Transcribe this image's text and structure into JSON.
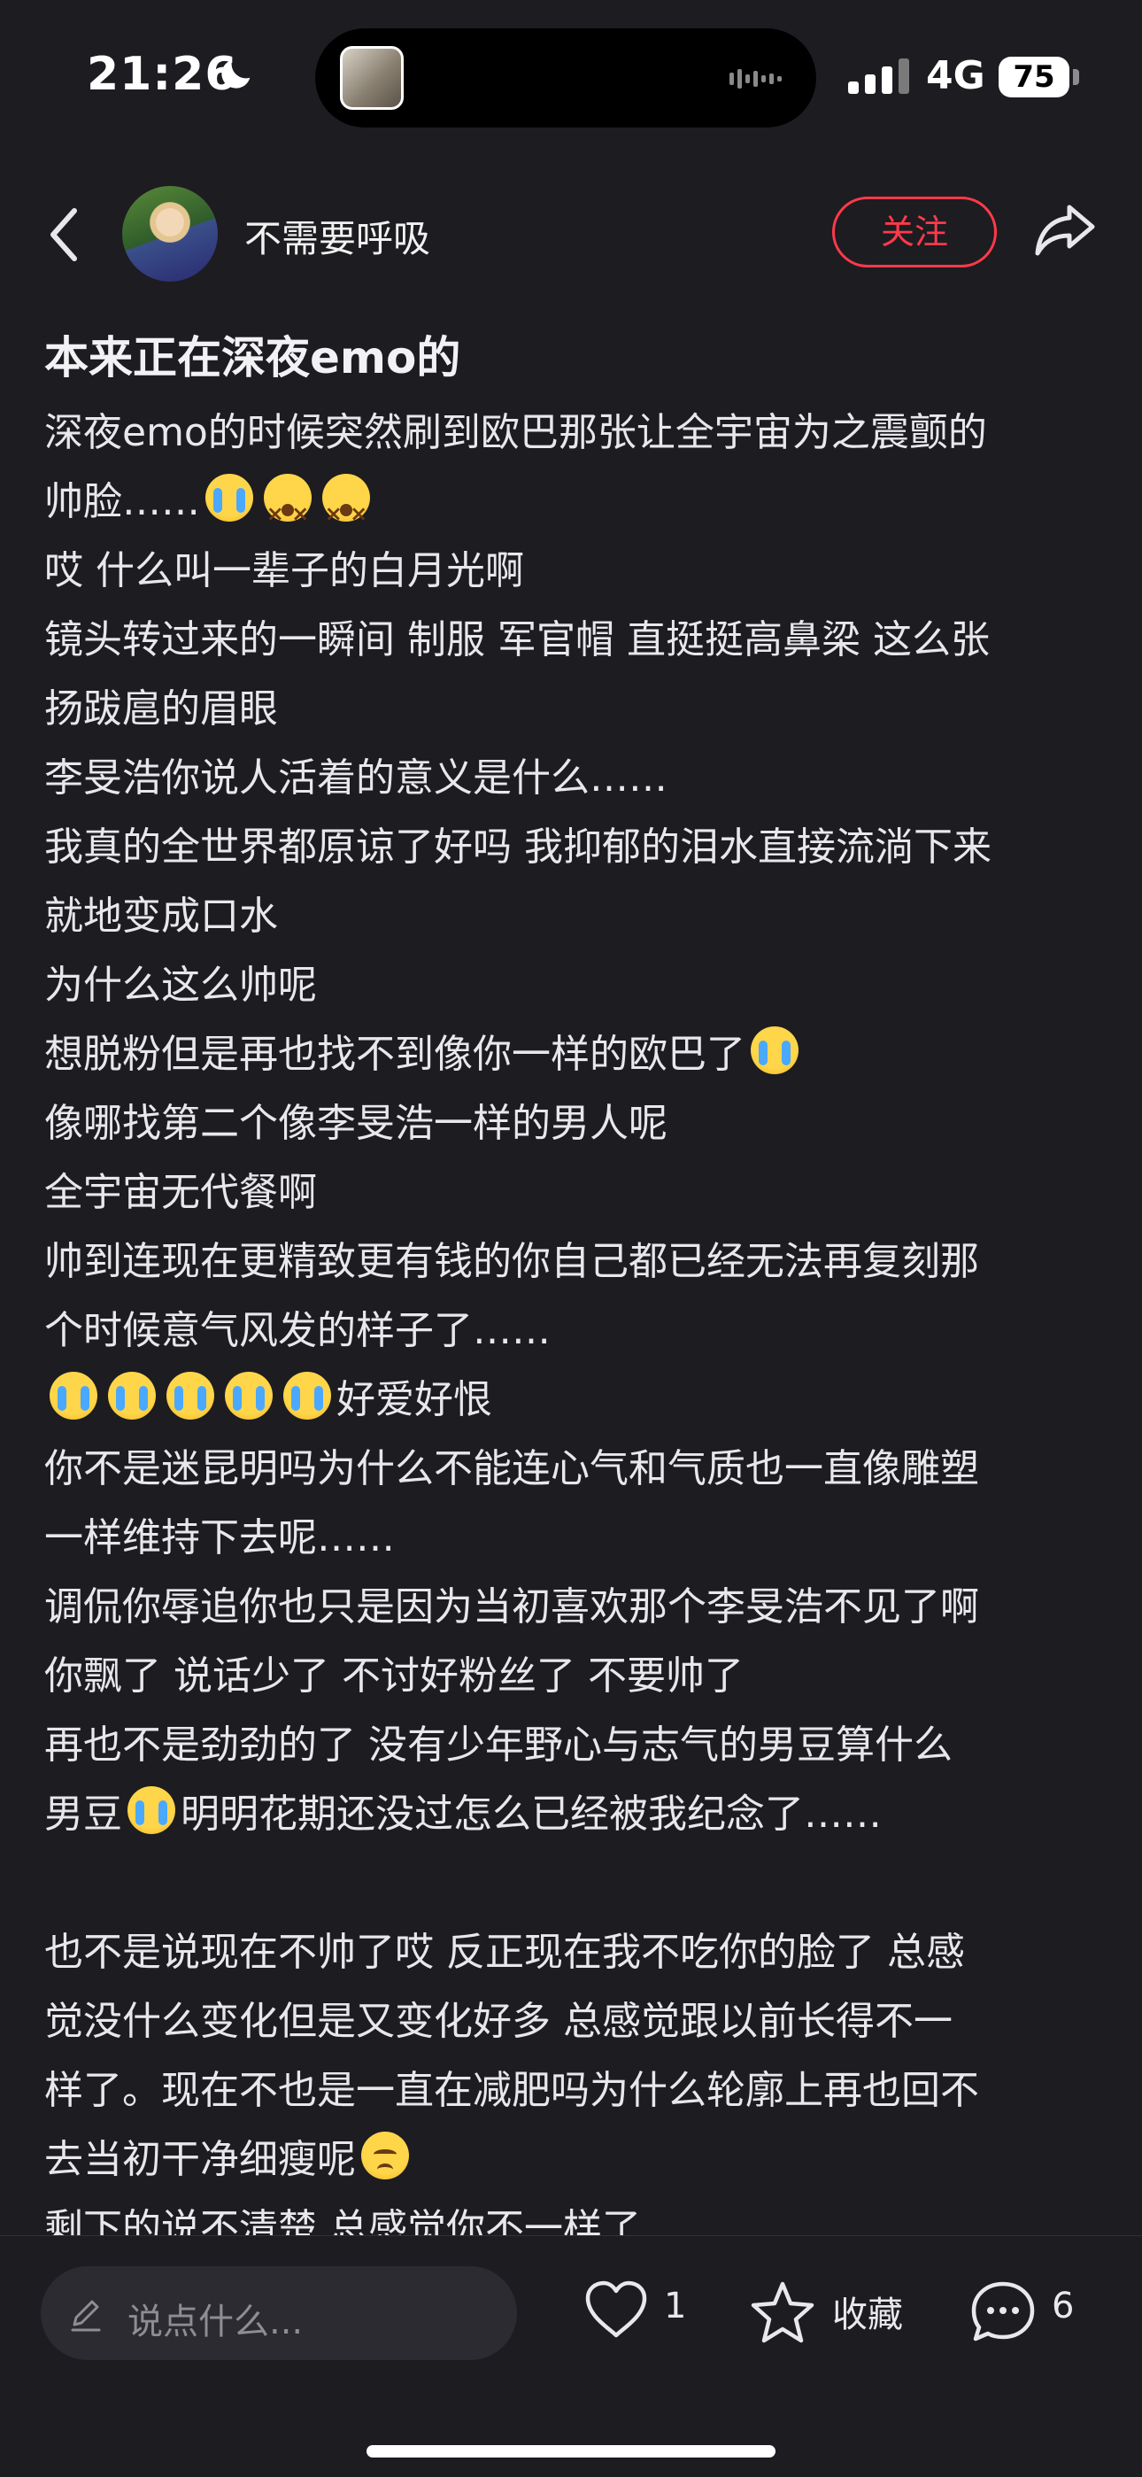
{
  "status_bar": {
    "time": "21:26",
    "network": "4G",
    "battery": "75",
    "icons": [
      "moon-icon",
      "signal-icon",
      "battery-icon",
      "waveform-icon"
    ]
  },
  "header": {
    "username": "不需要呼吸",
    "follow_label": "关注",
    "icons": [
      "back-icon",
      "share-icon"
    ]
  },
  "post": {
    "title": "本来正在深夜emo的",
    "lines": [
      "深夜emo的时候突然刷到欧巴那张让全宇宙为之震颤的",
      "帅脸……",
      "哎  什么叫一辈子的白月光啊",
      "镜头转过来的一瞬间 制服 军官帽 直挺挺高鼻梁  这么张",
      "扬跋扈的眉眼",
      "李旻浩你说人活着的意义是什么……",
      "我真的全世界都原谅了好吗 我抑郁的泪水直接流淌下来",
      "就地变成口水",
      "为什么这么帅呢",
      "想脱粉但是再也找不到像你一样的欧巴了",
      "像哪找第二个像李旻浩一样的男人呢",
      "全宇宙无代餐啊",
      "帅到连现在更精致更有钱的你自己都已经无法再复刻那",
      "个时候意气风发的样子了……",
      "好爱好恨",
      "你不是迷昆明吗为什么不能连心气和气质也一直像雕塑",
      "一样维持下去呢……",
      "调侃你辱追你也只是因为当初喜欢那个李旻浩不见了啊",
      "你飘了 说话少了 不讨好粉丝了 不要帅了",
      "再也不是劲劲的了   没有少年野心与志气的男豆算什么",
      "男豆",
      "明明花期还没过怎么已经被我纪念了……",
      "也不是说现在不帅了哎 反正现在我不吃你的脸了 总感",
      "觉没什么变化但是又变化好多  总感觉跟以前长得不一",
      "样了。现在不也是一直在减肥吗为什么轮廓上再也回不",
      "去当初干净细瘦呢",
      "剩下的说不清楚 总感觉你不一样了"
    ],
    "emoji": [
      "loudly-crying-face",
      "dizzy-face",
      "sad-face"
    ]
  },
  "bottom_bar": {
    "comment_placeholder": "说点什么...",
    "like_count": "1",
    "favorite_label": "收藏",
    "comment_count": "6",
    "icons": [
      "pencil-icon",
      "heart-icon",
      "star-icon",
      "comment-bubble-icon"
    ]
  },
  "colors": {
    "background": "#1d1c21",
    "text": "#e8e8ea",
    "follow_accent": "#ff3a4a",
    "input_bg": "#2c2b31"
  }
}
